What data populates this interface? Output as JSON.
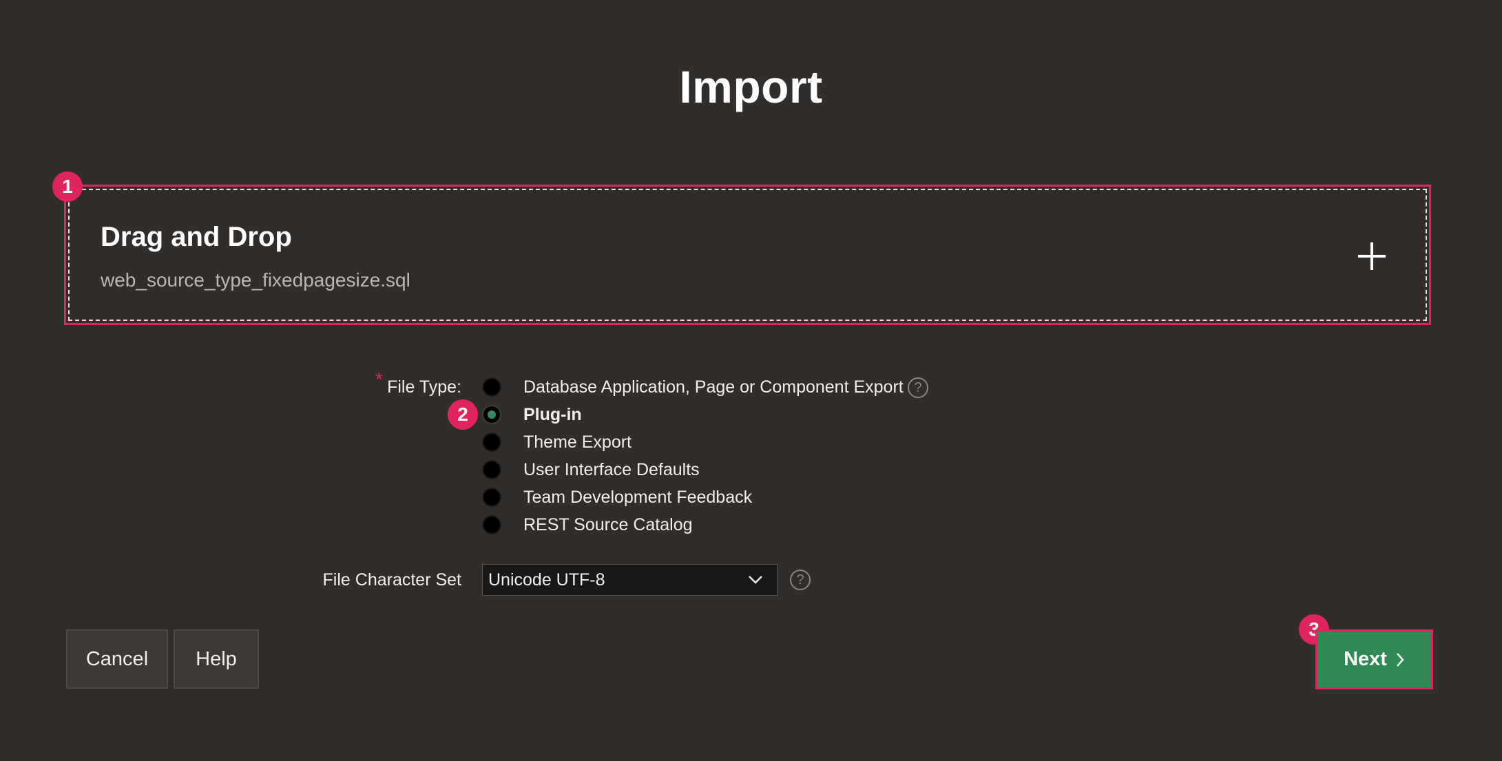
{
  "page": {
    "title": "Import"
  },
  "dropzone": {
    "title": "Drag and Drop",
    "filename": "web_source_type_fixedpagesize.sql",
    "badge": "1",
    "add_icon": "plus-icon"
  },
  "file_type": {
    "label": "File Type:",
    "required_marker": "*",
    "badge": "2",
    "selected": "Plug-in",
    "options": [
      {
        "label": "Database Application, Page or Component Export",
        "checked": false
      },
      {
        "label": "Plug-in",
        "checked": true
      },
      {
        "label": "Theme Export",
        "checked": false
      },
      {
        "label": "User Interface Defaults",
        "checked": false
      },
      {
        "label": "Team Development Feedback",
        "checked": false
      },
      {
        "label": "REST Source Catalog",
        "checked": false
      }
    ],
    "help_icon": "help-icon"
  },
  "charset": {
    "label": "File Character Set",
    "value": "Unicode UTF-8",
    "help_icon": "help-icon"
  },
  "buttons": {
    "cancel": "Cancel",
    "help": "Help",
    "next": "Next",
    "next_badge": "3"
  },
  "colors": {
    "background": "#312d2a",
    "highlight": "#e0245e",
    "primary_button": "#2f8a54"
  }
}
